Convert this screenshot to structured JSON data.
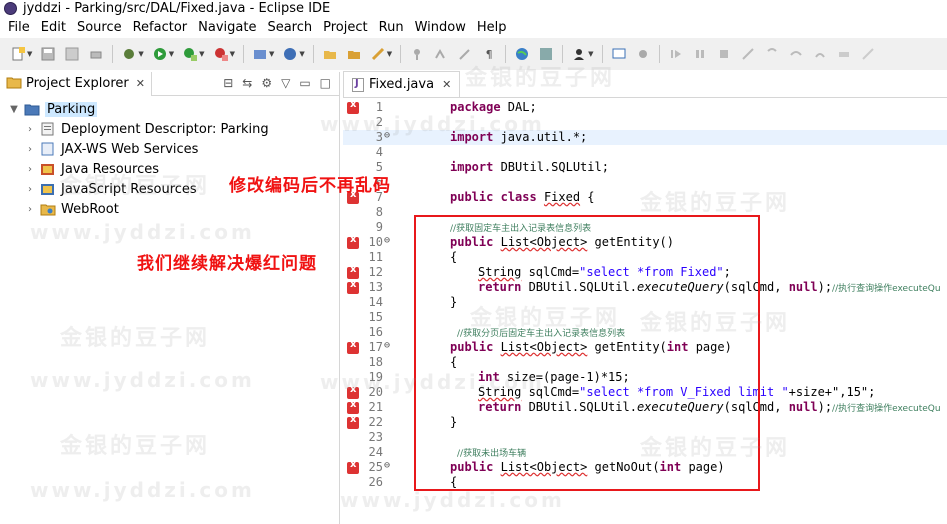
{
  "window": {
    "title": "jyddzi - Parking/src/DAL/Fixed.java - Eclipse IDE"
  },
  "menu": [
    "File",
    "Edit",
    "Source",
    "Refactor",
    "Navigate",
    "Search",
    "Project",
    "Run",
    "Window",
    "Help"
  ],
  "left_panel": {
    "tab_label": "Project Explorer",
    "tab_close": "✕",
    "tree": [
      {
        "label": "Parking",
        "expanded": true
      },
      {
        "label": "Deployment Descriptor: Parking"
      },
      {
        "label": "JAX-WS Web Services"
      },
      {
        "label": "Java Resources"
      },
      {
        "label": "JavaScript Resources"
      },
      {
        "label": "WebRoot"
      }
    ]
  },
  "annotations": {
    "note1": "修改编码后不再乱码",
    "note2": "我们继续解决爆红问题"
  },
  "watermark": {
    "cn": "金银的豆子网",
    "en": "www.jyddzi.com"
  },
  "editor": {
    "tab_label": "Fixed.java",
    "tab_close": "✕",
    "lines": {
      "l1": "1",
      "l2": "2",
      "l3": "3",
      "l4": "4",
      "l5": "5",
      "l6": "6",
      "l7": "7",
      "l8": "8",
      "l9": "9",
      "l10": "10",
      "l11": "11",
      "l12": "12",
      "l13": "13",
      "l14": "14",
      "l15": "15",
      "l16": "16",
      "l17": "17",
      "l18": "18",
      "l19": "19",
      "l20": "20",
      "l21": "21",
      "l22": "22",
      "l23": "23",
      "l24": "24",
      "l25": "25",
      "l26": "26"
    },
    "code": {
      "package_kw": "package",
      "package_name": " DAL;",
      "import_kw": "import",
      "import1": " java.util.*;",
      "import2": " DBUtil.SQLUtil;",
      "public": "public",
      "class": "class",
      "class_name": "Fixed",
      "class_open": " {",
      "comment1": "//获取固定车主出入记录表信息列表",
      "method1_ret": "List<Object>",
      "method1_name": " getEntity()",
      "brace_open": "{",
      "brace_close": "}",
      "string_type": "String",
      "sqlcmd1_decl": " sqlCmd=",
      "sqlcmd1_val": "\"select *from Fixed\"",
      "semicolon": ";",
      "return_kw": "return",
      "return_call_a": " DBUtil.SQLUtil.",
      "exec_query": "executeQuery",
      "return_call_b1": "(sqlCmd, ",
      "null_kw": "null",
      "return_call_c": ");",
      "comment_exec": "//执行查询操作executeQu",
      "comment2": "//获取分页后固定车主出入记录表信息列表",
      "method2_ret": "List<Object>",
      "method2_name_a": " getEntity(",
      "int_kw": "int",
      "method2_name_b": " page)",
      "size_decl_a": " size=(page-1)*15;",
      "sqlcmd2_val": "\"select *from V_Fixed limit \"",
      "sqlcmd2_tail": "+size+\",15\";",
      "comment3": "//获取未出场车辆",
      "method3_name_a": " getNoOut(",
      "method3_ret": "List<Object>"
    }
  }
}
